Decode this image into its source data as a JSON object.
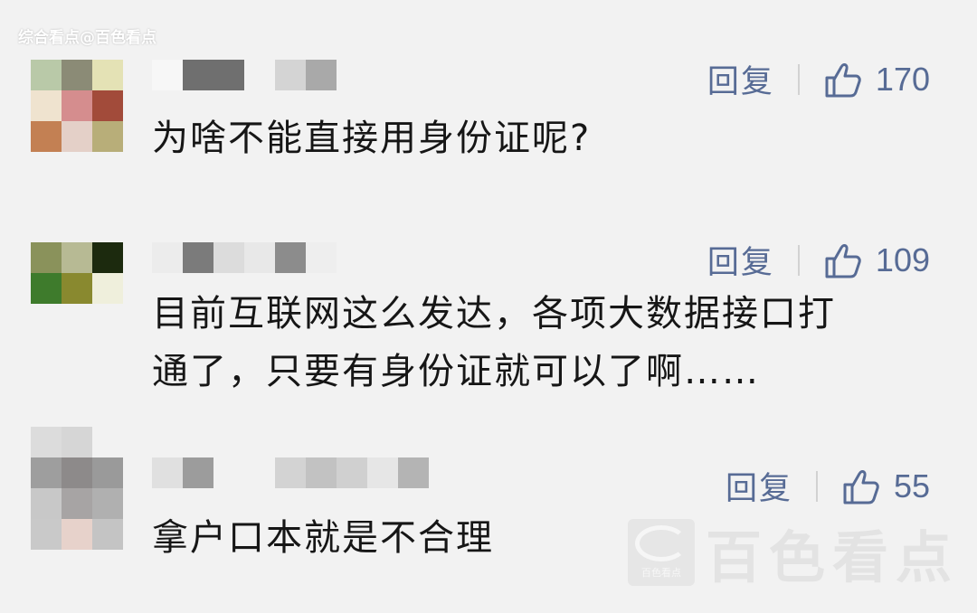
{
  "watermark": {
    "top_text": "综合看点@百色看点",
    "brand_name": "百色看点",
    "logo_caption": "百色看点"
  },
  "colors": {
    "background": "#f2f2f2",
    "action_blue": "#576b95",
    "text": "#161616"
  },
  "comments": [
    {
      "reply_label": "回复",
      "likes": "170",
      "text_lines": [
        "为啥不能直接用身份证呢?"
      ]
    },
    {
      "reply_label": "回复",
      "likes": "109",
      "text_lines": [
        "目前互联网这么发达，各项大数据接口打",
        "通了，只要有身份证就可以了啊……"
      ]
    },
    {
      "reply_label": "回复",
      "likes": "55",
      "text_lines": [
        "拿户口本就是不合理"
      ]
    }
  ]
}
